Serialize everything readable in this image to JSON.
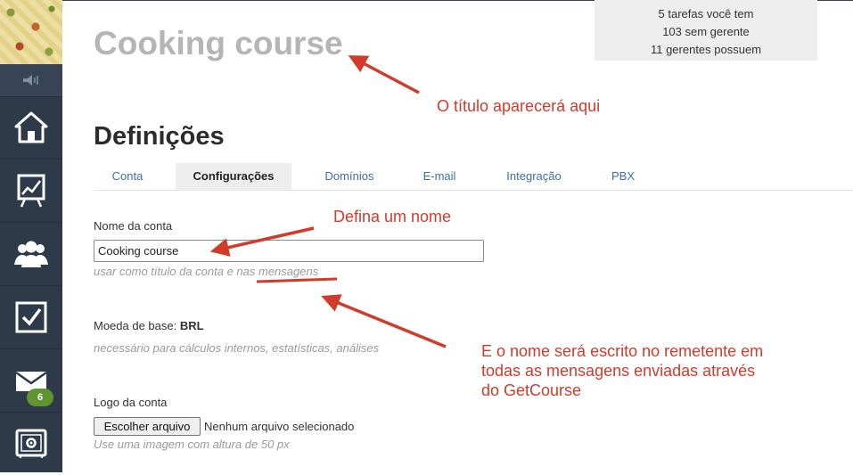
{
  "sidebar": {
    "mail_badge": "6"
  },
  "stats": {
    "line1": "5 tarefas você tem",
    "line2": "103 sem gerente",
    "line3": "11 gerentes possuem"
  },
  "page": {
    "course_title": "Cooking course",
    "section_title": "Definições"
  },
  "tabs": [
    {
      "label": "Conta"
    },
    {
      "label": "Configurações"
    },
    {
      "label": "Domínios"
    },
    {
      "label": "E-mail"
    },
    {
      "label": "Integração"
    },
    {
      "label": "PBX"
    }
  ],
  "form": {
    "account_name_label": "Nome da conta",
    "account_name_value": "Cooking course",
    "account_name_hint": "usar como título da conta e nas mensagens",
    "currency_label": "Moeda de base:",
    "currency_value": "BRL",
    "currency_hint": "necessário para cálculos internos, estatísticas, análises",
    "logo_label": "Logo da conta",
    "file_button": "Escolher arquivo",
    "file_status": "Nenhum arquivo selecionado",
    "logo_hint": "Use uma imagem com altura de 50 px"
  },
  "annotations": {
    "title_note": "O título aparecerá aqui",
    "name_note": "Defina um nome",
    "sender_note_1": "E o nome será escrito no remetente em",
    "sender_note_2": "todas as mensagens enviadas através",
    "sender_note_3": "do GetCourse",
    "color": "#d23b2a"
  }
}
